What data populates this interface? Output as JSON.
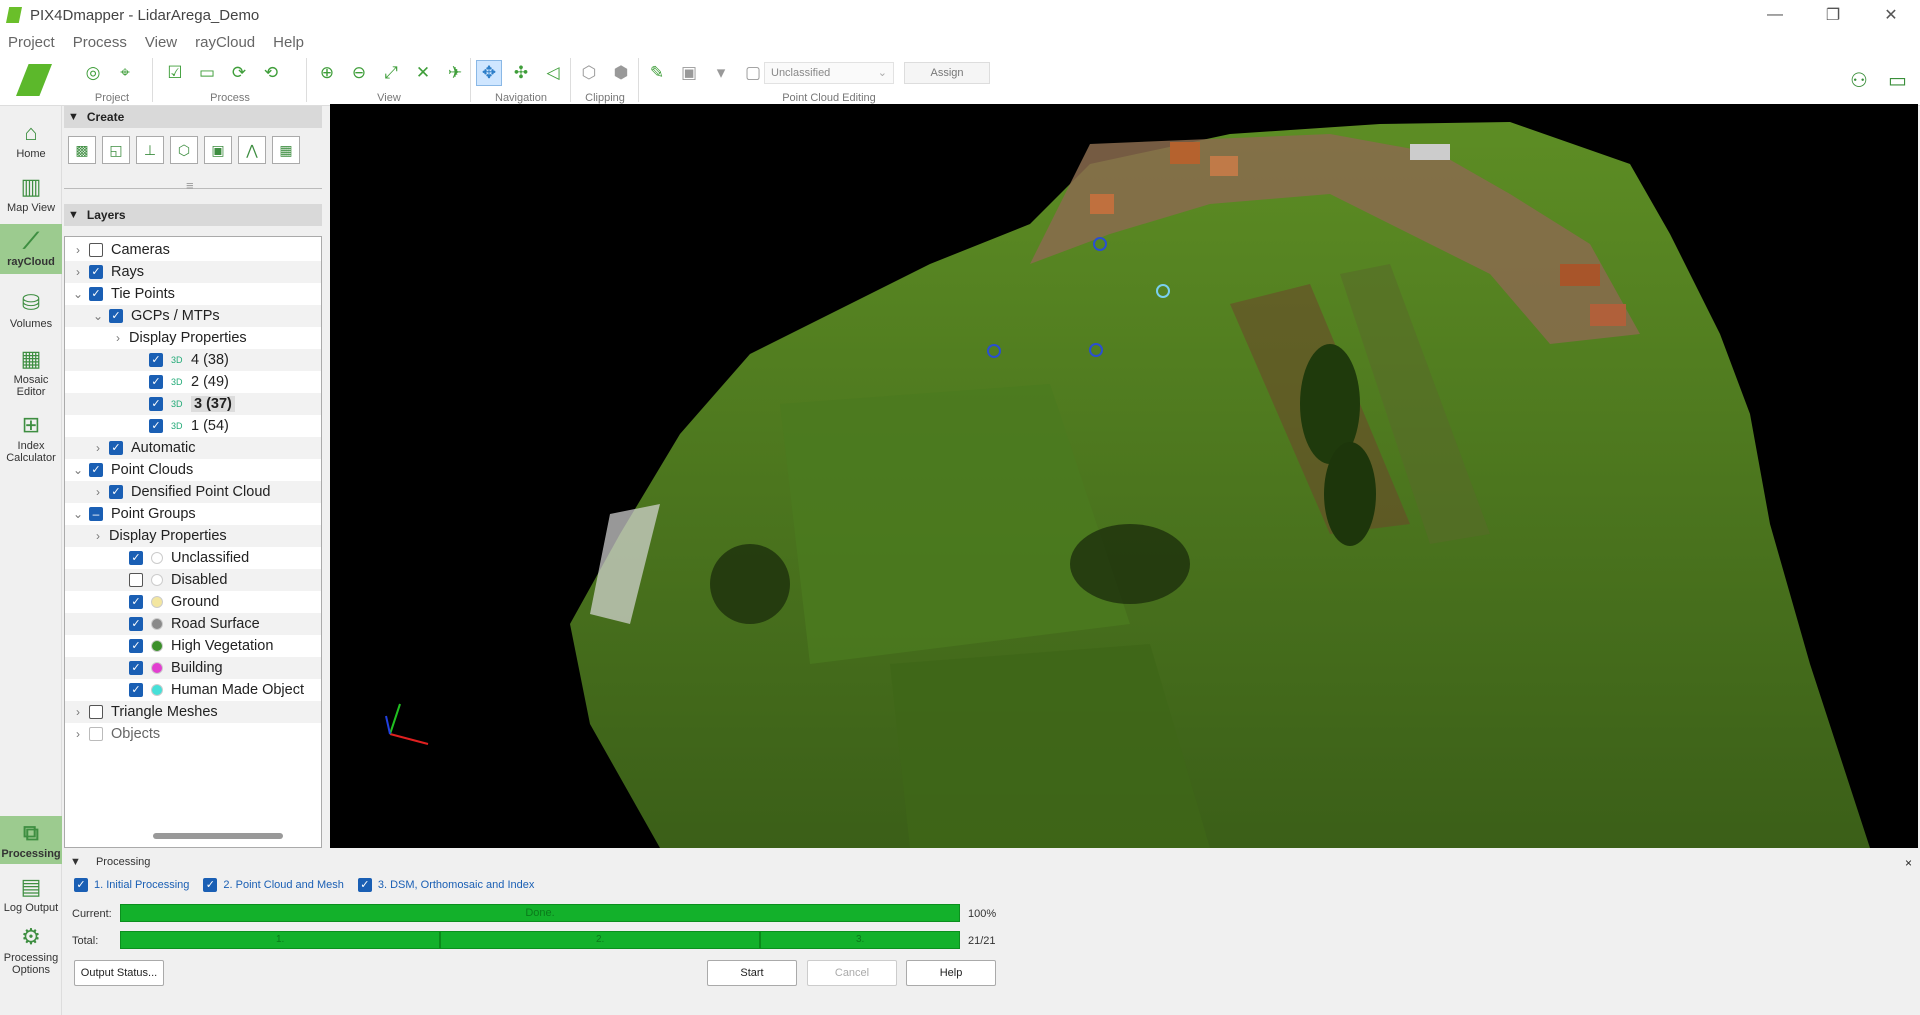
{
  "window": {
    "title": "PIX4Dmapper - LidarArega_Demo",
    "controls": [
      "—",
      "❐",
      "✕"
    ]
  },
  "menu": [
    "Project",
    "Process",
    "View",
    "rayCloud",
    "Help"
  ],
  "toolbar": {
    "groups": {
      "project": "Project",
      "process": "Process",
      "view": "View",
      "navigation": "Navigation",
      "clipping": "Clipping",
      "editing": "Point Cloud Editing"
    },
    "class_select": "Unclassified",
    "assign": "Assign"
  },
  "nav": {
    "home": "Home",
    "map_view": "Map View",
    "raycloud": "rayCloud",
    "volumes": "Volumes",
    "mosaic_editor": "Mosaic Editor",
    "index_calculator": "Index Calculator",
    "processing": "Processing",
    "log_output": "Log Output",
    "processing_options": "Processing Options"
  },
  "sidebar": {
    "create": "Create",
    "layers": "Layers"
  },
  "layers": [
    {
      "label": "Cameras",
      "indent": 0,
      "chev": "›",
      "cb": "off"
    },
    {
      "label": "Rays",
      "indent": 0,
      "chev": "›",
      "cb": "on"
    },
    {
      "label": "Tie Points",
      "indent": 0,
      "chev": "⌄",
      "cb": "on"
    },
    {
      "label": "GCPs / MTPs",
      "indent": 1,
      "chev": "⌄",
      "cb": "on"
    },
    {
      "label": "Display Properties",
      "indent": 2,
      "chev": "›",
      "cb": "none"
    },
    {
      "label": "4 (38)",
      "indent": 3,
      "chev": "",
      "cb": "on",
      "gcp": true
    },
    {
      "label": "2 (49)",
      "indent": 3,
      "chev": "",
      "cb": "on",
      "gcp": true
    },
    {
      "label": "3 (37)",
      "indent": 3,
      "chev": "",
      "cb": "on",
      "gcp": true,
      "selected": true
    },
    {
      "label": "1 (54)",
      "indent": 3,
      "chev": "",
      "cb": "on",
      "gcp": true
    },
    {
      "label": "Automatic",
      "indent": 1,
      "chev": "›",
      "cb": "on"
    },
    {
      "label": "Point Clouds",
      "indent": 0,
      "chev": "⌄",
      "cb": "on"
    },
    {
      "label": "Densified Point Cloud",
      "indent": 1,
      "chev": "›",
      "cb": "on"
    },
    {
      "label": "Point Groups",
      "indent": 0,
      "chev": "⌄",
      "cb": "partial"
    },
    {
      "label": "Display Properties",
      "indent": 1,
      "chev": "›",
      "cb": "none"
    },
    {
      "label": "Unclassified",
      "indent": 2,
      "chev": "",
      "cb": "on",
      "dot": "#ffffff"
    },
    {
      "label": "Disabled",
      "indent": 2,
      "chev": "",
      "cb": "off",
      "dot": "#ffffff"
    },
    {
      "label": "Ground",
      "indent": 2,
      "chev": "",
      "cb": "on",
      "dot": "#f3e6a0"
    },
    {
      "label": "Road Surface",
      "indent": 2,
      "chev": "",
      "cb": "on",
      "dot": "#8a8a8a"
    },
    {
      "label": "High Vegetation",
      "indent": 2,
      "chev": "",
      "cb": "on",
      "dot": "#3b8f2a"
    },
    {
      "label": "Building",
      "indent": 2,
      "chev": "",
      "cb": "on",
      "dot": "#e23fd0"
    },
    {
      "label": "Human Made Object",
      "indent": 2,
      "chev": "",
      "cb": "on",
      "dot": "#46e0d8"
    },
    {
      "label": "Triangle Meshes",
      "indent": 0,
      "chev": "›",
      "cb": "off"
    },
    {
      "label": "Objects",
      "indent": 0,
      "chev": "›",
      "cb": "dis"
    }
  ],
  "processing": {
    "title": "Processing",
    "steps": [
      "1. Initial Processing",
      "2. Point Cloud and Mesh",
      "3. DSM, Orthomosaic and Index"
    ],
    "current_label": "Current:",
    "current_text": "Done.",
    "current_pct": "100%",
    "total_label": "Total:",
    "total_segments": [
      "1.",
      "2.",
      "3."
    ],
    "total_count": "21/21",
    "output_status": "Output Status...",
    "start": "Start",
    "cancel": "Cancel",
    "help": "Help"
  },
  "colors": {
    "accent": "#3e8e41",
    "progress": "#13b12b",
    "checkbox": "#1a5fb4"
  }
}
